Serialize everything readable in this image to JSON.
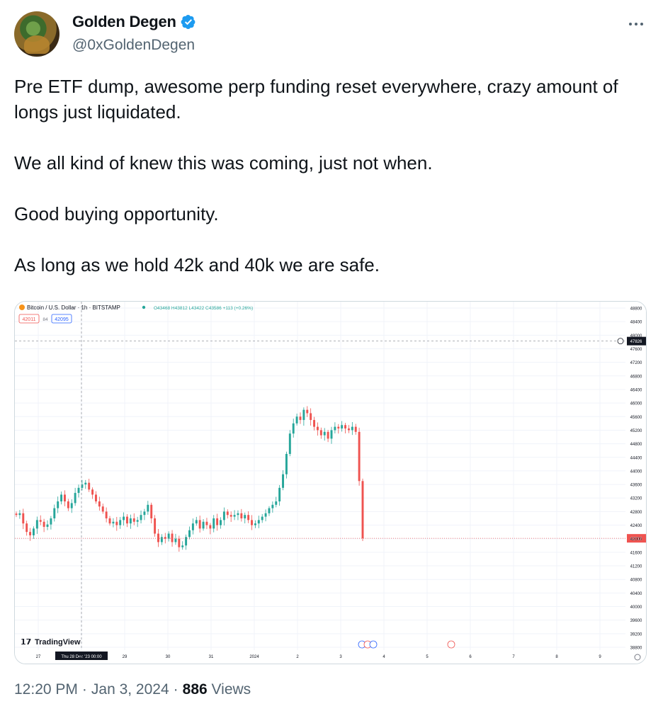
{
  "author": {
    "name": "Golden Degen",
    "handle": "@0xGoldenDegen",
    "avatar_icon": "pepe-avatar-icon",
    "verified_icon": "verified-badge-icon",
    "verified_color": "#1d9bf0"
  },
  "more_icon": "more-options-icon",
  "tweet": {
    "lines": [
      "Pre ETF dump, awesome perp funding reset everywhere, crazy amount of longs just liquidated.",
      "We all kind of knew this was coming, just not when.",
      "Good buying opportunity.",
      "As long as we hold 42k and 40k we are safe."
    ]
  },
  "footer": {
    "time": "12:20 PM",
    "date": "Jan 3, 2024",
    "views": "886",
    "views_label": "Views",
    "sep": "·"
  },
  "chart_header": {
    "symbol": "Bitcoin / U.S. Dollar · 1h · BITSTAMP",
    "ohlc": "O43468 H43812 L43422 C43586 +113 (+0.26%)",
    "bid": "42011",
    "spread": "84",
    "ask": "42095",
    "brand": "TradingView"
  },
  "chart_data": {
    "type": "candlestick",
    "title": "Bitcoin / U.S. Dollar · 1h · BITSTAMP",
    "y_ticks": [
      48800,
      48400,
      48000,
      47600,
      47200,
      46800,
      46400,
      46000,
      45600,
      45200,
      44800,
      44400,
      44000,
      43600,
      43200,
      42800,
      42400,
      42000,
      41600,
      41200,
      40800,
      40400,
      40000,
      39600,
      39200,
      38800
    ],
    "ylim": [
      38700,
      48900
    ],
    "x_ticks": [
      "27",
      "28",
      "29",
      "30",
      "31",
      "2024",
      "2",
      "3",
      "4",
      "5",
      "6",
      "7",
      "8",
      "9"
    ],
    "crosshair_x_label": "Thu 28 Dec '23   00:00",
    "crosshair_price": 47826,
    "last_price": 42012,
    "up_color": "#26a69a",
    "down_color": "#ef5350",
    "closes": [
      42700,
      42750,
      42450,
      42200,
      42100,
      42300,
      42550,
      42500,
      42350,
      42420,
      42600,
      42900,
      43100,
      43300,
      43100,
      42900,
      43050,
      43350,
      43500,
      43600,
      43650,
      43450,
      43300,
      43100,
      42950,
      42800,
      42600,
      42450,
      42500,
      42400,
      42550,
      42650,
      42450,
      42600,
      42500,
      42550,
      42700,
      42800,
      43000,
      42600,
      42150,
      41900,
      42050,
      42000,
      42150,
      41900,
      42000,
      41750,
      41800,
      42050,
      42250,
      42450,
      42550,
      42300,
      42500,
      42400,
      42300,
      42600,
      42400,
      42550,
      42800,
      42700,
      42650,
      42700,
      42750,
      42600,
      42700,
      42550,
      42400,
      42450,
      42550,
      42650,
      42750,
      42900,
      43000,
      43100,
      43500,
      43900,
      44500,
      45100,
      45400,
      45600,
      45500,
      45800,
      45700,
      45500,
      45300,
      45200,
      45050,
      45150,
      44950,
      45200,
      45300,
      45250,
      45350,
      45250,
      45200,
      45300,
      45150,
      43700,
      42012
    ]
  }
}
